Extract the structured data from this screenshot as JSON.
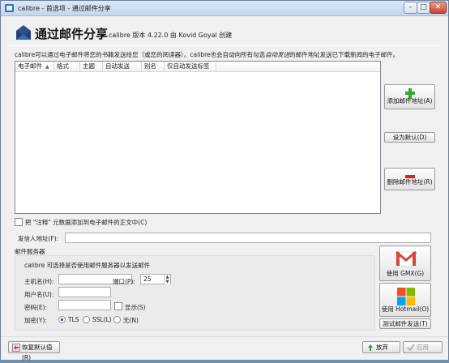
{
  "window": {
    "title": "calibre - 首选项 - 通过邮件分享"
  },
  "header": {
    "title": "通过邮件分享",
    "version": "calibre 版本 4.22.0 由 Kovid Goyal 创建"
  },
  "description": {
    "part1": "calibre可以通过电子邮件将您的书籍发送给您（或您的阅读器）。calibre也会自动向所有勾选",
    "italic": "自动发送",
    "part2": "的邮件地址发送已下载新闻的电子邮件。"
  },
  "table": {
    "columns": [
      "电子邮件",
      "格式",
      "主题",
      "自动发送",
      "别名",
      "仅自动发送标签"
    ],
    "rows": []
  },
  "side_buttons": {
    "add": "添加邮件地址(A)",
    "default": "设为默认(D)",
    "remove": "删除邮件地址(R)"
  },
  "checkbox_notes": {
    "label": "把 \"注释\" 元数据添加到电子邮件的正文中(C)",
    "checked": false
  },
  "sender": {
    "label": "发信人地址(F):",
    "value": ""
  },
  "mail_server": {
    "section_label": "邮件服务器",
    "intro": "calibre 可选择是否使用邮件服务器以发送邮件",
    "hostname_label": "主机名(H):",
    "hostname_value": "",
    "port_label": "端口(P):",
    "port_value": "25",
    "username_label": "用户名(U):",
    "username_value": "",
    "password_label": "密码(E):",
    "password_value": "",
    "show_label": "显示(S)",
    "show_checked": false,
    "encryption_label": "加密(Y):",
    "encryption_options": [
      "TLS",
      "SSL(L)",
      "无(N)"
    ],
    "encryption_selected": "TLS"
  },
  "providers": {
    "gmx": "使用 GMX(G)",
    "hotmail": "使用 Hotmail(O)",
    "test": "测试邮件发送(T)"
  },
  "footer": {
    "restore": "恢复默认值(R)",
    "discard": "放弃",
    "apply": "应用"
  },
  "colors": {
    "add_green": "#3aa33a",
    "remove_red": "#d32424",
    "gmail_red": "#d44638"
  }
}
